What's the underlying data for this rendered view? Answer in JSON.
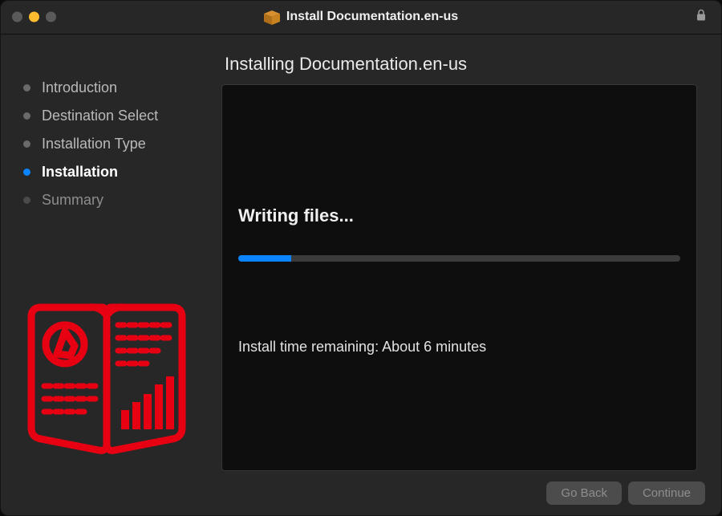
{
  "window": {
    "title": "Install Documentation.en-us"
  },
  "sidebar": {
    "steps": [
      {
        "label": "Introduction",
        "state": "done"
      },
      {
        "label": "Destination Select",
        "state": "done"
      },
      {
        "label": "Installation Type",
        "state": "done"
      },
      {
        "label": "Installation",
        "state": "active"
      },
      {
        "label": "Summary",
        "state": "pending"
      }
    ]
  },
  "main": {
    "heading": "Installing Documentation.en-us",
    "status": "Writing files...",
    "progress_percent": 12,
    "remaining": "Install time remaining: About 6 minutes"
  },
  "footer": {
    "back": "Go Back",
    "continue": "Continue",
    "back_enabled": false,
    "continue_enabled": false
  },
  "icons": {
    "titlebar_package": "package-icon",
    "titlebar_lock": "lock-icon"
  },
  "colors": {
    "accent": "#0a84ff",
    "artwork": "#e60012"
  }
}
